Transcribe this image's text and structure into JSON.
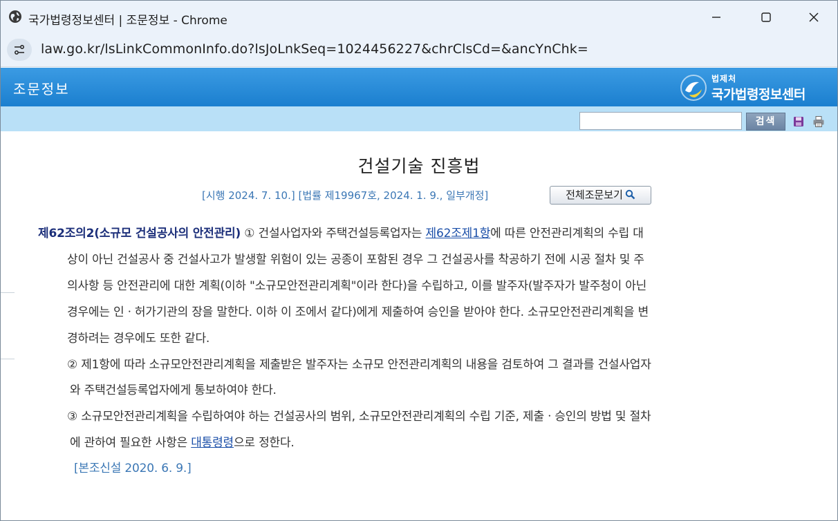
{
  "window": {
    "title": "국가법령정보센터 | 조문정보 - Chrome",
    "url": "law.go.kr/lsLinkCommonInfo.do?lsJoLnkSeq=1024456227&chrClsCd=&ancYnChk="
  },
  "header": {
    "title": "조문정보",
    "logo_small": "법제처",
    "logo_big": "국가법령정보센터"
  },
  "search": {
    "value": "",
    "button_label": "검색"
  },
  "law": {
    "title": "건설기술 진흥법",
    "meta": "[시행 2024. 7. 10.] [법률 제19967호, 2024. 1. 9., 일부개정]",
    "full_text_button": "전체조문보기"
  },
  "article": {
    "heading": "제62조의2(소규모 건설공사의 안전관리)",
    "p1_a": " ① 건설사업자와 주택건설등록업자는 ",
    "link1": "제62조",
    "link2": "제1항",
    "p1_b": "에 따른 안전관리계획의 수립 대",
    "p1_l2": "상이 아닌 건설공사 중 건설사고가 발생할 위험이 있는 공종이 포함된 경우 그 건설공사를 착공하기 전에 시공 절차 및 주",
    "p1_l3": "의사항 등 안전관리에 대한 계획(이하 \"소규모안전관리계획\"이라 한다)을 수립하고, 이를 발주자(발주자가 발주청이 아닌",
    "p1_l4": "경우에는 인ㆍ허가기관의 장을 말한다. 이하 이 조에서 같다)에게 제출하여 승인을 받아야 한다. 소규모안전관리계획을 변",
    "p1_l5": "경하려는 경우에도 또한 같다.",
    "p2_l1": "② 제1항에 따라 소규모안전관리계획을 제출받은 발주자는 소규모 안전관리계획의 내용을 검토하여 그 결과를 건설사업자",
    "p2_l2": "와 주택건설등록업자에게 통보하여야 한다.",
    "p3_l1": "③ 소규모안전관리계획을 수립하여야 하는 건설공사의 범위, 소규모안전관리계획의 수립 기준, 제출ㆍ승인의 방법 및 절차",
    "p3_l2_a": "에 관하여 필요한 사항은 ",
    "link3": "대통령령",
    "p3_l2_b": "으로 정한다.",
    "note": "[본조신설 2020. 6. 9.]"
  },
  "colors": {
    "header_blue": "#1b7fcf",
    "search_row": "#b9e0f7",
    "heading_navy": "#1c2f7a",
    "link_blue": "#1a4ea8",
    "meta_blue": "#3b77b5"
  },
  "icons": {
    "site": "globe-icon",
    "site_info": "tune-icon",
    "minimize": "minimize-icon",
    "maximize": "maximize-icon",
    "close": "close-icon",
    "save": "save-icon",
    "print": "print-icon",
    "search": "magnifier-icon"
  }
}
